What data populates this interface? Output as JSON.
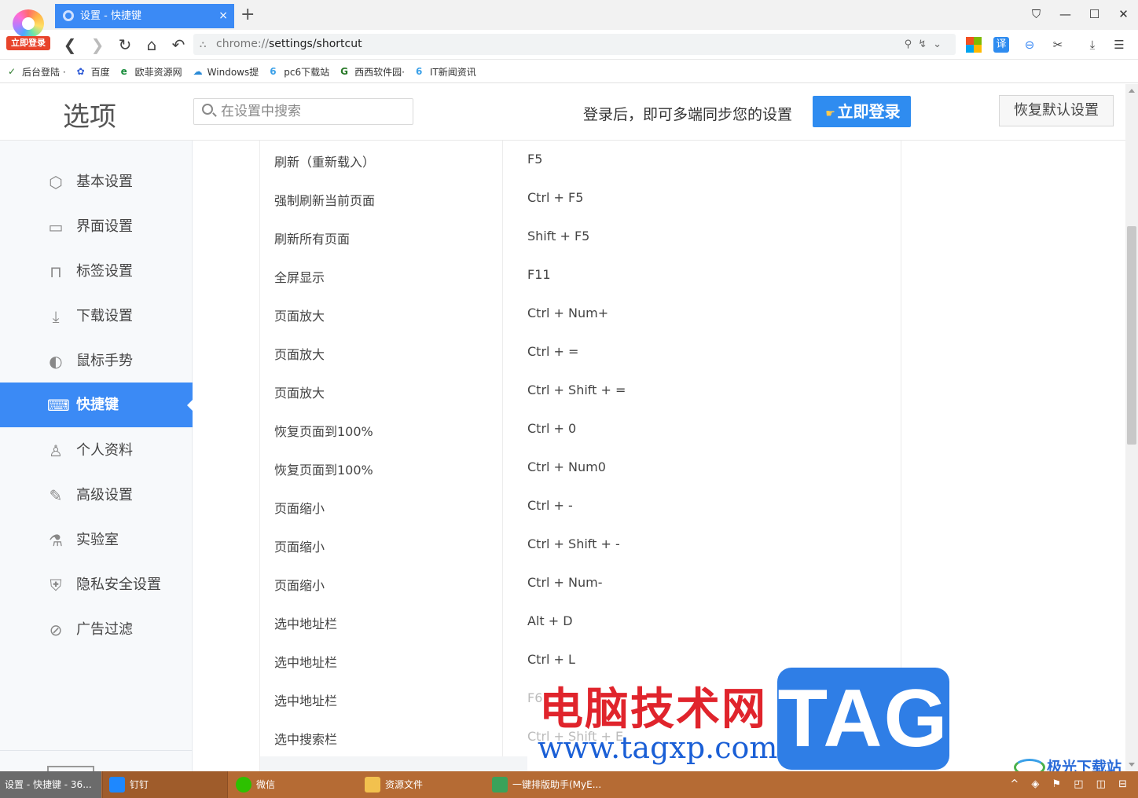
{
  "browser": {
    "login_badge": "立即登录",
    "tab_title": "设置 - 快捷键",
    "tab_close": "×",
    "new_tab": "+",
    "url_scheme": "chrome://",
    "url_path": "settings/shortcut",
    "window_controls": [
      "⛉",
      "—",
      "☐",
      "✕"
    ]
  },
  "bookmarks": [
    {
      "icon": "✓",
      "label": "后台登陆 ·"
    },
    {
      "icon": "✿",
      "label": "百度"
    },
    {
      "icon": "e",
      "label": "欧菲资源网"
    },
    {
      "icon": "☁",
      "label": "Windows提"
    },
    {
      "icon": "6",
      "label": "pc6下载站"
    },
    {
      "icon": "G",
      "label": "西西软件园·"
    },
    {
      "icon": "6",
      "label": "IT新闻资讯"
    }
  ],
  "header": {
    "title": "选项",
    "search_placeholder": "在设置中搜索",
    "sync_text": "登录后，即可多端同步您的设置",
    "login_button": "立即登录",
    "reset_button": "恢复默认设置"
  },
  "sidebar": {
    "items": [
      {
        "label": "基本设置",
        "icon": "⬡"
      },
      {
        "label": "界面设置",
        "icon": "▭"
      },
      {
        "label": "标签设置",
        "icon": "⊓"
      },
      {
        "label": "下载设置",
        "icon": "⤓"
      },
      {
        "label": "鼠标手势",
        "icon": "◐"
      },
      {
        "label": "快捷键",
        "icon": "⌨"
      },
      {
        "label": "个人资料",
        "icon": "♙"
      },
      {
        "label": "高级设置",
        "icon": "✎"
      },
      {
        "label": "实验室",
        "icon": "⚗"
      },
      {
        "label": "隐私安全设置",
        "icon": "⛨"
      },
      {
        "label": "广告过滤",
        "icon": "⊘"
      }
    ],
    "active_index": 5
  },
  "shortcuts": [
    {
      "action": "刷新（重新载入）",
      "keys": "F5"
    },
    {
      "action": "强制刷新当前页面",
      "keys": "Ctrl + F5"
    },
    {
      "action": "刷新所有页面",
      "keys": "Shift + F5"
    },
    {
      "action": "全屏显示",
      "keys": "F11"
    },
    {
      "action": "页面放大",
      "keys": "Ctrl + Num+"
    },
    {
      "action": "页面放大",
      "keys": "Ctrl + ="
    },
    {
      "action": "页面放大",
      "keys": "Ctrl + Shift + ="
    },
    {
      "action": "恢复页面到100%",
      "keys": "Ctrl + 0"
    },
    {
      "action": "恢复页面到100%",
      "keys": "Ctrl + Num0"
    },
    {
      "action": "页面缩小",
      "keys": "Ctrl + -"
    },
    {
      "action": "页面缩小",
      "keys": "Ctrl + Shift + -"
    },
    {
      "action": "页面缩小",
      "keys": "Ctrl + Num-"
    },
    {
      "action": "选中地址栏",
      "keys": "Alt + D"
    },
    {
      "action": "选中地址栏",
      "keys": "Ctrl + L"
    },
    {
      "action": "选中地址栏",
      "keys": "F6"
    },
    {
      "action": "选中搜索栏",
      "keys": "Ctrl + Shift + E"
    }
  ],
  "watermark": {
    "cn_text": "电脑技术网",
    "url_text": "www.tagxp.com",
    "tag_text": "TAG",
    "jg_text": "极光下载站"
  },
  "taskbar": {
    "items": [
      {
        "label": "设置 - 快捷键 - 36...",
        "color": "#777777"
      },
      {
        "label": "钉钉",
        "color": "#1e88ff"
      },
      {
        "label": "微信",
        "color": "#2dc100"
      },
      {
        "label": "资源文件",
        "color": "#f2c14e"
      },
      {
        "label": "一键排版助手(MyE...",
        "color": "#3aa25a"
      }
    ],
    "tray": "^ ◈ ⚑ ◰ ◫ ⊟"
  }
}
